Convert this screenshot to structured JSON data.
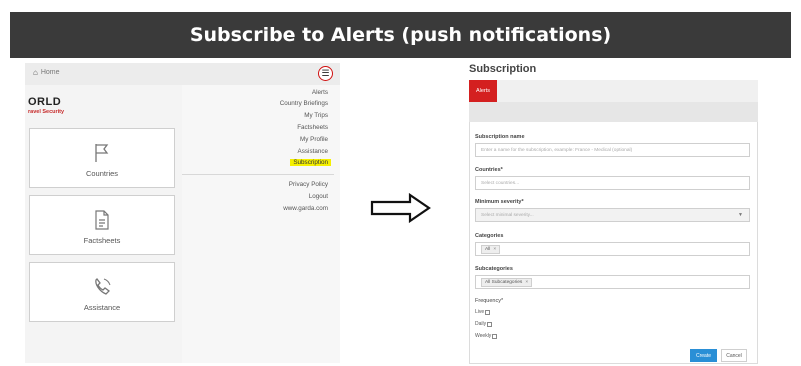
{
  "banner": {
    "title": "Subscribe to Alerts (push notifications)"
  },
  "mobile": {
    "home_label": "Home",
    "home_icon": "home-icon",
    "menu_icon": "hamburger-menu-icon",
    "logo_main": "ORLD",
    "logo_sub": "ravel Security",
    "tiles": [
      {
        "label": "Countries",
        "icon": "flag-icon"
      },
      {
        "label": "Factsheets",
        "icon": "document-icon"
      },
      {
        "label": "Assistance",
        "icon": "phone-icon"
      }
    ],
    "menu_items": [
      "Alerts",
      "Country Briefings",
      "My Trips",
      "Factsheets",
      "My Profile",
      "Assistance",
      "Subscription"
    ],
    "menu_items_secondary": [
      "Privacy Policy",
      "Logout",
      "www.garda.com"
    ],
    "highlighted_item": "Subscription",
    "highlight_color": "#f5f000"
  },
  "arrow": {
    "icon": "right-arrow-icon"
  },
  "form": {
    "title": "Subscription",
    "tab_label": "Alerts",
    "tab_color": "#d42020",
    "subscription_name": {
      "label": "Subscription name",
      "placeholder": "Enter a name for the subscription, example: France - Medical (optional)"
    },
    "countries": {
      "label": "Countries*",
      "placeholder": "Select countries..."
    },
    "severity": {
      "label": "Minimum severity*",
      "placeholder": "Select minimal severity..."
    },
    "categories": {
      "label": "Categories",
      "chip": "All"
    },
    "subcategories": {
      "label": "Subcategories",
      "chip": "All Subcategories"
    },
    "frequency": {
      "label": "Frequency*",
      "options": [
        "Live",
        "Daily",
        "Weekly"
      ]
    },
    "create_label": "Create",
    "cancel_label": "Cancel",
    "create_color": "#2a8fd6"
  }
}
